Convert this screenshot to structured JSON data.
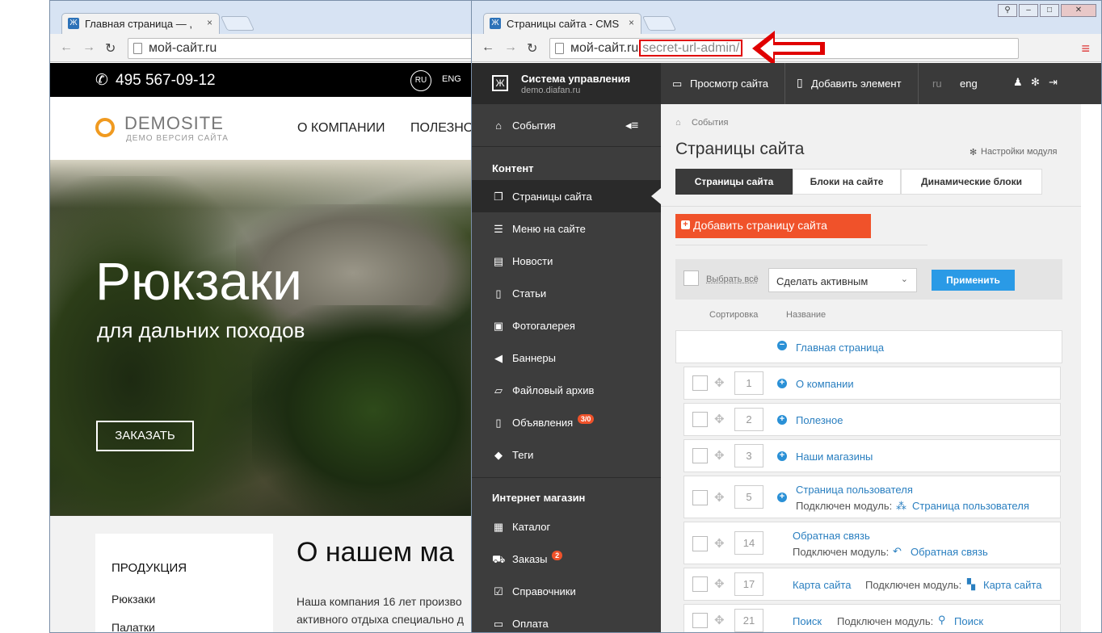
{
  "left_window": {
    "tab_title": "Главная страница — ,",
    "url": "мой-сайт.ru",
    "phone": "495 567-09-12",
    "lang_ru": "RU",
    "lang_en": "ENG",
    "logo_main": "DEMOSITE",
    "logo_sub": "ДЕМО ВЕРСИЯ САЙТА",
    "nav": [
      "О КОМПАНИИ",
      "ПОЛЕЗНО"
    ],
    "hero_title": "Рюкзаки",
    "hero_subtitle": "для дальних походов",
    "hero_button": "ЗАКАЗАТЬ",
    "products_heading": "ПРОДУКЦИЯ",
    "products": [
      "Рюкзаки",
      "Палатки"
    ],
    "about_heading": "О нашем ма",
    "about_text_1": "Наша компания 16 лет произво",
    "about_text_2": "активного отдыха специально д"
  },
  "right_window": {
    "tab_title": "Страницы сайта - CMS",
    "url_base": "мой-сайт.ru",
    "url_path": "secret-url-admin/",
    "header": {
      "cms_name": "Система управления",
      "cms_domain": "demo.diafan.ru",
      "view_site": "Просмотр сайта",
      "add_element": "Добавить элемент",
      "lang_ru": "ru",
      "lang_eng": "eng"
    },
    "sidebar": {
      "events": "События",
      "content_heading": "Контент",
      "content_items": [
        "Страницы сайта",
        "Меню на сайте",
        "Новости",
        "Статьи",
        "Фотогалерея",
        "Баннеры",
        "Файловый архив",
        "Объявления",
        "Теги"
      ],
      "ads_badge": "3/0",
      "shop_heading": "Интернет магазин",
      "shop_items": [
        "Каталог",
        "Заказы",
        "Справочники",
        "Оплата"
      ],
      "orders_badge": "2"
    },
    "main": {
      "breadcrumb": "События",
      "title": "Страницы сайта",
      "module_settings": "Настройки модуля",
      "tabs": [
        "Страницы сайта",
        "Блоки на сайте",
        "Динамические блоки"
      ],
      "add_button": "Добавить страницу сайта",
      "select_all": "Выбрать всё",
      "action_select": "Сделать активным",
      "apply": "Применить",
      "col_sort": "Сортировка",
      "col_name": "Название",
      "module_label": "Подключен модуль:",
      "root_page": "Главная страница",
      "rows": [
        {
          "sort": "1",
          "name": "О компании",
          "module": ""
        },
        {
          "sort": "2",
          "name": "Полезное",
          "module": ""
        },
        {
          "sort": "3",
          "name": "Наши магазины",
          "module": ""
        },
        {
          "sort": "5",
          "name": "Страница пользователя",
          "module": "Страница пользователя"
        },
        {
          "sort": "14",
          "name": "Обратная связь",
          "module": "Обратная связь"
        },
        {
          "sort": "17",
          "name": "Карта сайта",
          "module": "Карта сайта"
        },
        {
          "sort": "21",
          "name": "Поиск",
          "module": "Поиск"
        }
      ]
    }
  },
  "colors": {
    "accent_red": "#f0522a",
    "link_blue": "#2a7fc0",
    "apply_blue": "#2a9ae6",
    "annotation_red": "#e00000"
  }
}
